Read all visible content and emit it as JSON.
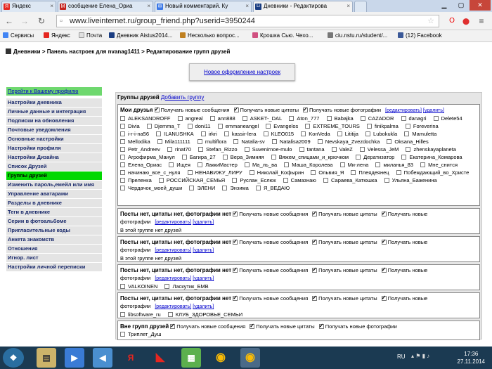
{
  "tabs": [
    {
      "label": "Яндекс",
      "icon": "Я",
      "color": "#e52620"
    },
    {
      "label": "сообщение Елена_Ориа",
      "icon": "M",
      "color": "#c5221f"
    },
    {
      "label": "Новый комментарий. Ку",
      "icon": "✉",
      "color": "#3b78e7"
    },
    {
      "label": "Дневники - Редактирова",
      "icon": "Li",
      "color": "#1a3d82"
    }
  ],
  "address": {
    "url": "www.liveinternet.ru/group_friend.php?userid=3950244"
  },
  "bookmarks": [
    {
      "label": "Сервисы",
      "color": "#4285f4"
    },
    {
      "label": "Яндекс",
      "color": "#e52620"
    },
    {
      "label": "Почта",
      "color": "#e0e0e0"
    },
    {
      "label": "Дневник Aistus2014...",
      "color": "#1a3d82"
    },
    {
      "label": "Несколько вопрос...",
      "color": "#c08020"
    },
    {
      "label": "Крошка Сью. Чехо...",
      "color": "#d05080"
    },
    {
      "label": "ciu.nstu.ru/student/...",
      "color": "#777777"
    },
    {
      "label": "(12) Facebook",
      "color": "#3b5998"
    }
  ],
  "breadcrumb": {
    "a": "Дневники",
    "sep1": ">",
    "b": "Панель настроек для nvanag1411",
    "sep2": ">",
    "c": "Редактирование групп друзей"
  },
  "new_design_button": "Новое оформление настроек",
  "sidebar": [
    "Перейти к Вашему профилю",
    "Настройки дневника",
    "Личные данные и интеграция",
    "Подписки на обновления",
    "Почтовые уведомления",
    "Основные настройки",
    "Настройки профиля",
    "Настройки Дизайна",
    "Список Друзей",
    "Группы друзей",
    "Изменить пароль,емейл или имя",
    "Управление аватарами",
    "Разделы в дневнике",
    "Теги в дневнике",
    "Серии в фотоальбоме",
    "Пригласительные коды",
    "Анкета знакомств",
    "Отношения",
    "Игнор. лист",
    "Настройки личной переписки"
  ],
  "panel": {
    "title": "Группы друзей",
    "add": "Добавить группу"
  },
  "labels": {
    "msg": "Получать новые сообщения",
    "quotes": "Получать новые цитаты",
    "photos": "Получать новые фотографии",
    "edit": "[редактировать]",
    "del": "[удалить]",
    "empty": "В этой группе нет друзей"
  },
  "groups": [
    {
      "name": "Мои друзья",
      "friends": [
        "ALEKSANDROFF",
        "angreal",
        "ann888",
        "ASKET-_DAL",
        "Aton_777",
        "Babajka",
        "CAZADOR",
        "danagri",
        "Delete54",
        "Divia",
        "Djemma_T",
        "doni11",
        "emmaneangel",
        "Evangelos",
        "EXTREME_TOURS",
        "finikpalma",
        "Foreverina",
        "i-r-i-na56",
        "ILANUSHKA",
        "irkri",
        "kassir-lera",
        "KLEO015",
        "KonVeda",
        "Lititija",
        "Lubokukla",
        "Mamuletta",
        "Mellodika",
        "Mila111111",
        "multiflora",
        "Natalia-sv",
        "Natalisa2009",
        "Nevskaya_Zvezdochka",
        "Oksana_Hilles",
        "Petr_Andreev",
        "rinat70",
        "Stefan_Rizzo",
        "Suvenirnoe-mulo",
        "tantana",
        "ValeZ",
        "Velessa_JeM",
        "zhenskayaplaneta",
        "Агрофирма_Манул",
        "Багира_27",
        "Вера_Зимняя",
        "Вяжем_спицами_и_крючком",
        "Дератизатор",
        "Екатерина_Комарова",
        "Елена_Ориас",
        "Ищея",
        "ЛаккиМастер",
        "Ма_ль_ва",
        "Маша_Королева",
        "Ми-лена",
        "миланья_83",
        "Мне_снится",
        "начинаю_все_с_нуля",
        "НЕНАВИЖУ_ЛИРУ",
        "Николай_Кофырин",
        "Ольвия_Я",
        "Плеядеянец",
        "Побеждающий_во_Христе",
        "Преленка",
        "РОССИЙСКАЯ_СЕМЬЯ",
        "Руслан_Еслюк",
        "Самазнаю",
        "Сараева_Катюшка",
        "Ульяна_Баженина",
        "Чердачок_моей_души",
        "ЭЛЕНИ",
        "Энзима",
        "Я_ВЕДАЮ"
      ]
    },
    {
      "name": "Посты нет, цитаты нет, фотографии нет",
      "friends": []
    },
    {
      "name": "Посты нет, цитаты нет, фотографии нет",
      "friends": []
    },
    {
      "name": "Посты нет, цитаты нет, фотографии нет",
      "friends": [
        "VALKOINEN",
        "Ласкутик_БМВ"
      ]
    },
    {
      "name": "Посты нет, цитаты нет, фотографии нет",
      "friends": [
        "libsoftware_ru",
        "КЛУБ_ЗДОРОВЬЕ_СЕМЬИ"
      ]
    },
    {
      "name": "Вне групп друзей",
      "friends": [
        "Триплет_Душ"
      ]
    }
  ],
  "taskbar": {
    "lang": "RU",
    "time": "17:36",
    "date": "27.11.2014"
  }
}
